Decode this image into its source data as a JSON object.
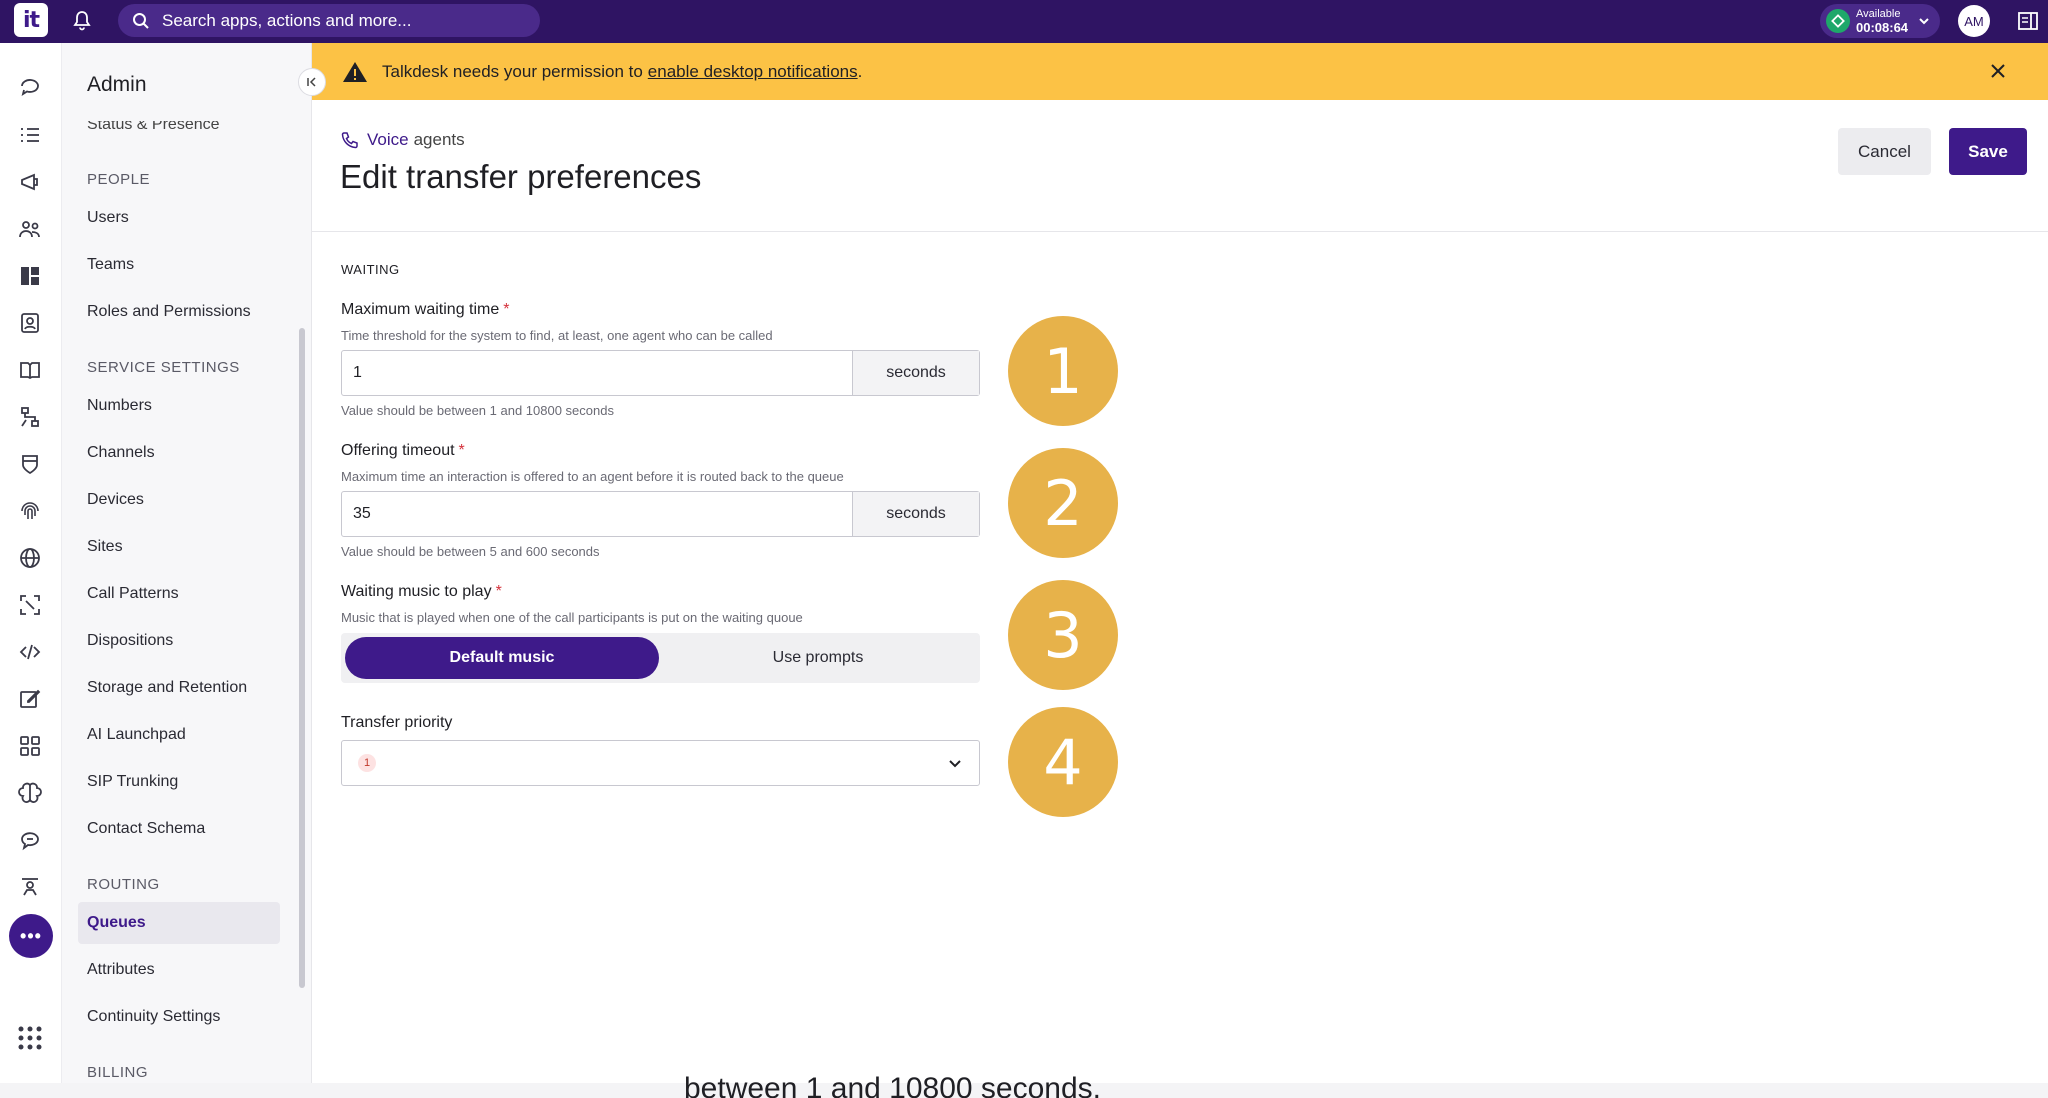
{
  "topbar": {
    "logo_text": "it",
    "search_placeholder": "Search apps, actions and more...",
    "status_label": "Available",
    "status_timer": "00:08:64",
    "avatar_initials": "AM"
  },
  "nav": {
    "title": "Admin",
    "cut_item": "Status & Presence",
    "sections": [
      {
        "label": "PEOPLE",
        "items": [
          "Users",
          "Teams",
          "Roles and Permissions"
        ]
      },
      {
        "label": "SERVICE SETTINGS",
        "items": [
          "Numbers",
          "Channels",
          "Devices",
          "Sites",
          "Call Patterns",
          "Dispositions",
          "Storage and Retention",
          "AI Launchpad",
          "SIP Trunking",
          "Contact Schema"
        ]
      },
      {
        "label": "ROUTING",
        "items": [
          "Queues",
          "Attributes",
          "Continuity Settings"
        ]
      },
      {
        "label": "BILLING",
        "items": []
      }
    ],
    "active_item": "Queues"
  },
  "banner": {
    "text": "Talkdesk needs your permission to",
    "link": "enable desktop notifications",
    "suffix": "."
  },
  "header": {
    "crumb_link": "Voice",
    "crumb_rest": "agents",
    "title": "Edit transfer preferences",
    "cancel_label": "Cancel",
    "save_label": "Save"
  },
  "form": {
    "section": "WAITING",
    "max_wait": {
      "label": "Maximum waiting time",
      "help": "Time threshold for the system to find, at least, one agent who can be called",
      "value": "1",
      "unit": "seconds",
      "hint": "Value should be between 1 and 10800 seconds"
    },
    "offer_timeout": {
      "label": "Offering timeout",
      "help": "Maximum time an interaction is offered to an agent before it is routed back to the queue",
      "value": "35",
      "unit": "seconds",
      "hint": "Value should be between 5 and 600 seconds"
    },
    "music": {
      "label": "Waiting music to play",
      "help": "Music that is played when one of the call participants is put on the waiting quoue",
      "option_on": "Default music",
      "option_off": "Use prompts"
    },
    "priority": {
      "label": "Transfer priority",
      "value": "1"
    }
  },
  "steps": [
    "1",
    "2",
    "3",
    "4"
  ],
  "caption": "between 1 and 10800 seconds."
}
